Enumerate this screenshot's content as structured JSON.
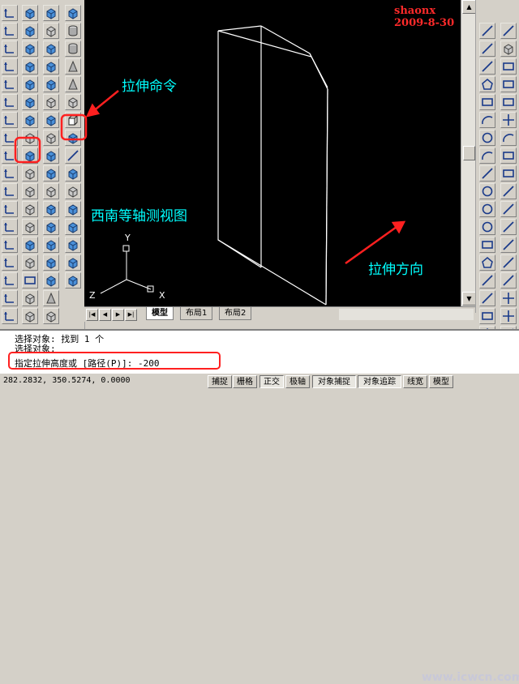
{
  "signature": "shaonx 2009-8-30",
  "annotations": {
    "extrude_command": "拉伸命令",
    "sw_iso_view": "西南等轴测视图",
    "extrude_direction": "拉伸方向"
  },
  "ucs": {
    "x": "X",
    "y": "Y",
    "z": "Z"
  },
  "tabs": [
    "模型",
    "布局1",
    "布局2"
  ],
  "command_lines": [
    "选择对象: 找到 1 个",
    "选择对象:",
    "指定拉伸高度或 [路径(P)]: -200"
  ],
  "status": {
    "coords": "282.2832, 350.5274, 0.0000",
    "buttons": [
      "捕捉",
      "栅格",
      "正交",
      "极轴",
      "对象捕捉",
      "对象追踪",
      "线宽",
      "模型"
    ]
  },
  "watermark": "www.icwcn.com",
  "colors": {
    "highlight": "#ff2020",
    "annotation": "#00ffff",
    "canvas": "#000000"
  }
}
